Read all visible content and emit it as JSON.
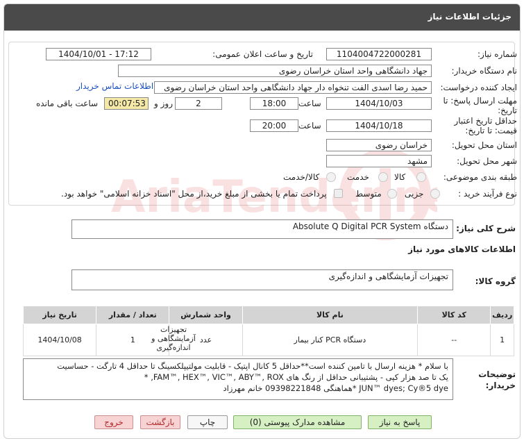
{
  "header": {
    "title": "جزئیات اطلاعات نیاز"
  },
  "form": {
    "need_number_label": "شماره نیاز:",
    "need_number": "1104004722000281",
    "announce_label": "تاریخ و ساعت اعلان عمومی:",
    "announce_value": "1404/10/01 - 17:12",
    "buyer_label": "نام دستگاه خریدار:",
    "buyer_value": "جهاد دانشگاهی واحد استان خراسان رضوی",
    "creator_label": "ایجاد کننده درخواست:",
    "creator_value": "حمید رضا اسدی الفت تنخواه دار جهاد دانشگاهی واحد استان خراسان رضوی",
    "contact_link": "اطلاعات تماس خریدار",
    "deadline_label_1": "مهلت ارسال پاسخ: تا",
    "deadline_label_2": "تاریخ:",
    "deadline_date": "1404/10/03",
    "time_label": "ساعت",
    "deadline_time": "18:00",
    "days_value": "2",
    "days_label": "روز و",
    "remaining_time": "00:07:53",
    "remaining_label": "ساعت باقی مانده",
    "validity_label_1": "حداقل تاریخ اعتبار",
    "validity_label_2": "قیمت: تا تاریخ:",
    "validity_date": "1404/10/18",
    "validity_time": "20:00",
    "province_label": "استان محل تحویل:",
    "province_value": "خراسان رضوی",
    "city_label": "شهر محل تحویل:",
    "city_value": "مشهد",
    "category_label": "طبقه بندی موضوعی:",
    "category_options": [
      "کالا",
      "خدمت",
      "کالا/خدمت"
    ],
    "process_label": "نوع فرآیند خرید :",
    "process_options": [
      "جزیی",
      "متوسط"
    ],
    "payment_note": "پرداخت تمام یا بخشی از مبلغ خرید،از محل \"اسناد خزانه اسلامی\" خواهد بود."
  },
  "summary": {
    "label": "شرح کلی نیاز:",
    "value": "دستگاه Absolute Q Digital PCR System"
  },
  "goods_info": {
    "title": "اطلاعات کالاهای مورد نیاز",
    "group_label": "گروه کالا:",
    "group_value": "تجهیزات آزمایشگاهی و اندازه‌گیری"
  },
  "table": {
    "headers": [
      "ردیف",
      "کد کالا",
      "نام کالا",
      "واحد شمارش",
      "تعداد / مقدار",
      "تاریخ نیاز"
    ],
    "rows": [
      [
        "1",
        "--",
        "دستگاه PCR کنار بیمار",
        "عدد",
        "1",
        "1404/10/08"
      ]
    ],
    "row_group_lines": [
      "تجهیزات",
      "آزمایشگاهی و",
      "اندازه‌گیری"
    ]
  },
  "buyer_notes": {
    "label_1": "توضیحات",
    "label_2": "خریدار:",
    "line1": "با سلام * هزینه ارسال با تامین کننده است**حداقل 5 کانال اپتیک - قابلیت مولتیپلکسینگ تا  حداقل 4 تارگت - حساسیت",
    "line2": "یک تا صد هزار کپی - پشتیبانی حداقل از رنگ های FAM™, HEX™, VIC™, ABY™, ROX, *",
    "line3": "JUN™ dyes; Cy®5 dye *هماهنگی  09398221848 خانم مهرزاد"
  },
  "buttons": {
    "reply": "پاسخ به نیاز",
    "attachments": "مشاهده مدارک پیوستی (0)",
    "print": "چاپ",
    "back": "بازگشت",
    "exit": "خروج"
  },
  "watermark_text": "AriaTender.net",
  "colors": {
    "header_bg": "#4a4a4a",
    "link": "#1a4fc2",
    "timer_bg": "#f4e9a6",
    "table_head": "#d4d4d4"
  }
}
